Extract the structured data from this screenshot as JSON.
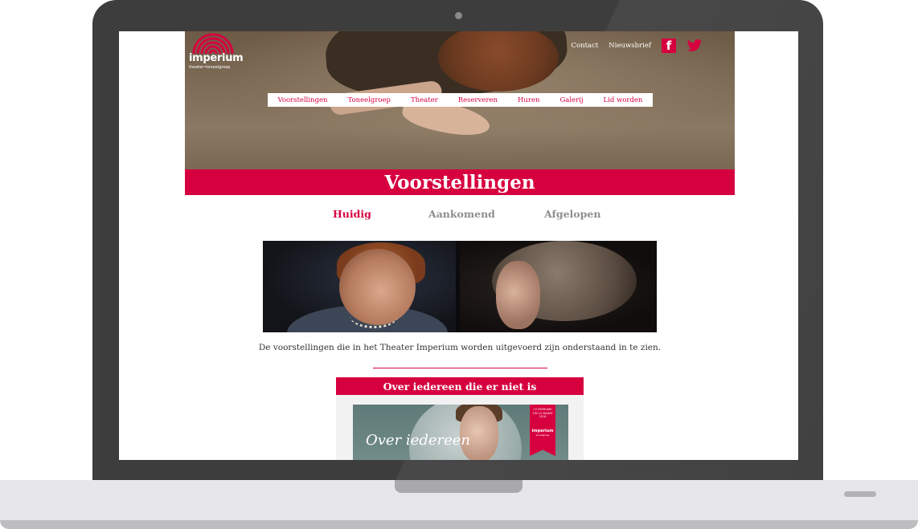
{
  "site": {
    "logo_name": "imperium",
    "logo_sub": "theater•toneelgroep"
  },
  "top_links": {
    "contact": "Contact",
    "newsletter": "Nieuwsbrief",
    "facebook_icon": "facebook-icon",
    "twitter_icon": "twitter-icon"
  },
  "nav": {
    "items": [
      {
        "label": "Voorstellingen"
      },
      {
        "label": "Toneelgroep"
      },
      {
        "label": "Theater"
      },
      {
        "label": "Reserveren"
      },
      {
        "label": "Huren"
      },
      {
        "label": "Galerij"
      },
      {
        "label": "Lid worden"
      }
    ]
  },
  "page": {
    "title": "Voorstellingen",
    "intro": "De voorstellingen die in het Theater Imperium worden uitgevoerd zijn onderstaand in te zien."
  },
  "tabs": [
    {
      "label": "Huidig",
      "active": true
    },
    {
      "label": "Aankomend",
      "active": false
    },
    {
      "label": "Afgelopen",
      "active": false
    }
  ],
  "show_card": {
    "title": "Over iedereen die er niet is",
    "poster_script": "Over iedereen",
    "ribbon_dates": "23 FEBRUARI T/M 12 MAART 2016",
    "ribbon_logo": "imperium",
    "ribbon_sub": "toneelgroep"
  },
  "colors": {
    "accent": "#d7003f",
    "inactive_tab": "#8e8e8e",
    "frame": "#3e3d3e"
  }
}
